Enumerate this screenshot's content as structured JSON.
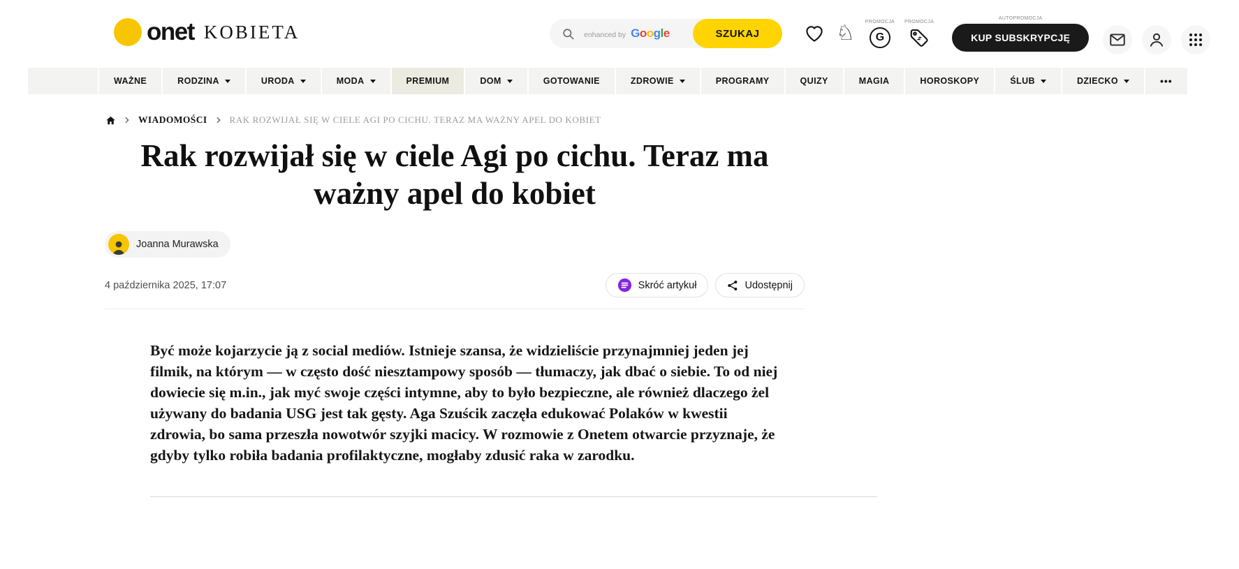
{
  "header": {
    "logo": {
      "brand": "onet",
      "section": "KOBIETA"
    },
    "search": {
      "placeholder_prefix": "enhanced by",
      "google_letters": [
        "G",
        "o",
        "o",
        "g",
        "l",
        "e"
      ],
      "button": "SZUKAJ"
    },
    "promos": {
      "g_letter": "G",
      "g_label": "PROMOCJA",
      "tag_label": "PROMOCJA",
      "auto_label": "AUTOPROMOCJA"
    },
    "subscribe_button": "KUP SUBSKRYPCJĘ"
  },
  "nav": {
    "items": [
      {
        "label": "WAŻNE"
      },
      {
        "label": "RODZINA"
      },
      {
        "label": "URODA"
      },
      {
        "label": "MODA"
      },
      {
        "label": "PREMIUM"
      },
      {
        "label": "DOM"
      },
      {
        "label": "GOTOWANIE"
      },
      {
        "label": "ZDROWIE"
      },
      {
        "label": "PROGRAMY"
      },
      {
        "label": "QUIZY"
      },
      {
        "label": "MAGIA"
      },
      {
        "label": "HOROSKOPY"
      },
      {
        "label": "ŚLUB"
      },
      {
        "label": "DZIECKO"
      }
    ],
    "more": "•••"
  },
  "breadcrumb": {
    "section": "WIADOMOŚCI",
    "current": "RAK ROZWIJAŁ SIĘ W CIELE AGI PO CICHU. TERAZ MA WAŻNY APEL DO KOBIET"
  },
  "article": {
    "title": "Rak rozwijał się w ciele Agi po cichu. Teraz ma ważny apel do kobiet",
    "author": "Joanna Murawska",
    "date": "4 października 2025, 17:07",
    "actions": {
      "summarize": "Skróć artykuł",
      "share": "Udostępnij"
    },
    "lead": "Być może kojarzycie ją z social mediów. Istnieje szansa, że widzieliście przynajmniej jeden jej filmik, na którym — w często dość niesztampowy sposób — tłumaczy, jak dbać o siebie. To od niej dowiecie się m.in., jak myć swoje części intymne, aby to było bezpieczne, ale również dlaczego żel używany do badania USG jest tak gęsty. Aga Szuścik zaczęła edukować Polaków w kwestii zdrowia, bo sama przeszła nowotwór szyjki macicy. W rozmowie z Onetem otwarcie przyznaje, że gdyby tylko robiła badania profilaktyczne, mogłaby zdusić raka w zarodku."
  },
  "colors": {
    "brand_yellow": "#f7c600",
    "search_button_yellow": "#ffd400",
    "subscribe_black": "#1a1a1a",
    "summarize_purple": "#8326e0",
    "premium_tile": "#ecebe1"
  }
}
